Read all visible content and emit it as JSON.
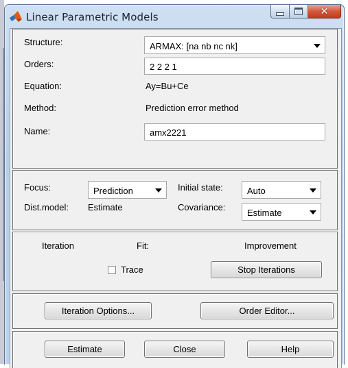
{
  "window": {
    "title": "Linear Parametric Models",
    "close_glyph": "✕",
    "icon": "matlab-icon"
  },
  "model": {
    "structure_label": "Structure:",
    "structure_value": "ARMAX: [na nb nc nk]",
    "orders_label": "Orders:",
    "orders_value": "2 2 2 1",
    "equation_label": "Equation:",
    "equation_value": "Ay=Bu+Ce",
    "method_label": "Method:",
    "method_value": "Prediction error method",
    "name_label": "Name:",
    "name_value": "amx2221"
  },
  "options": {
    "focus_label": "Focus:",
    "focus_value": "Prediction",
    "initial_state_label": "Initial state:",
    "initial_state_value": "Auto",
    "dist_model_label": "Dist.model:",
    "dist_model_value": "Estimate",
    "covariance_label": "Covariance:",
    "covariance_value": "Estimate"
  },
  "iteration": {
    "iteration_label": "Iteration",
    "fit_label": "Fit:",
    "improvement_label": "Improvement",
    "trace_label": "Trace",
    "stop_button": "Stop Iterations"
  },
  "tools": {
    "iteration_options_button": "Iteration Options...",
    "order_editor_button": "Order Editor..."
  },
  "actions": {
    "estimate_button": "Estimate",
    "close_button": "Close",
    "help_button": "Help"
  }
}
